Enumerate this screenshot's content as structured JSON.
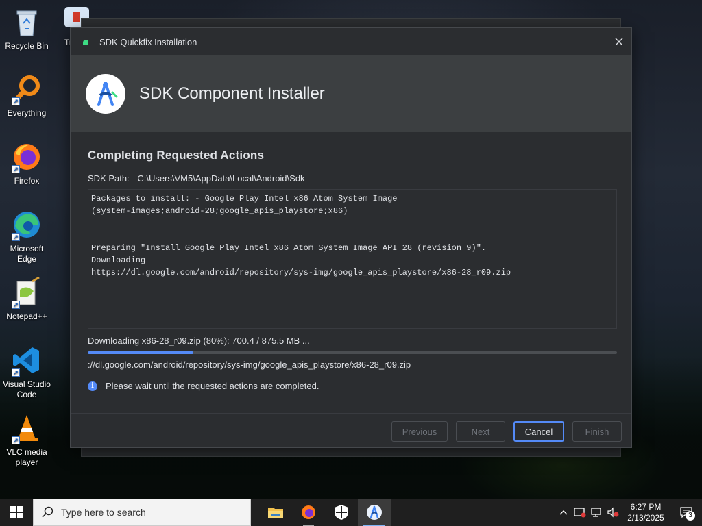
{
  "desktop": {
    "icons": [
      {
        "label": "Recycle Bin",
        "icon": "recycle-bin-icon"
      },
      {
        "label": "Everything",
        "icon": "everything-search-icon"
      },
      {
        "label": "Firefox",
        "icon": "firefox-icon"
      },
      {
        "label": "Microsoft Edge",
        "icon": "edge-icon"
      },
      {
        "label": "Notepad++",
        "icon": "notepadpp-icon"
      },
      {
        "label": "Visual Studio Code",
        "icon": "vscode-icon"
      },
      {
        "label": "VLC media player",
        "icon": "vlc-icon"
      }
    ],
    "partial_labels": [
      "Trac"
    ]
  },
  "dialog": {
    "window_title": "SDK Quickfix Installation",
    "banner_title": "SDK Component Installer",
    "section_title": "Completing Requested Actions",
    "sdk_path_label": "SDK Path:",
    "sdk_path_value": "C:\\Users\\VM5\\AppData\\Local\\Android\\Sdk",
    "log_lines": [
      "Packages to install: - Google Play Intel x86 Atom System Image",
      "(system-images;android-28;google_apis_playstore;x86)",
      "",
      "Preparing \"Install Google Play Intel x86 Atom System Image API 28 (revision 9)\".",
      "Downloading",
      "https://dl.google.com/android/repository/sys-img/google_apis_playstore/x86-28_r09.zip"
    ],
    "progress_label": "Downloading x86-28_r09.zip (80%): 700.4 / 875.5 MB ...",
    "progress_fraction": 0.2,
    "progress_url": "://dl.google.com/android/repository/sys-img/google_apis_playstore/x86-28_r09.zip",
    "info_message": "Please wait until the requested actions are completed.",
    "buttons": {
      "previous": "Previous",
      "next": "Next",
      "cancel": "Cancel",
      "finish": "Finish"
    }
  },
  "taskbar": {
    "search_placeholder": "Type here to search",
    "apps": [
      "file-explorer-icon",
      "firefox-icon",
      "security-icon",
      "android-studio-icon"
    ],
    "time": "6:27 PM",
    "date": "2/13/2025",
    "notification_count": "3"
  },
  "colors": {
    "accent": "#548af7",
    "dialog_bg": "#2b2d30",
    "banner_bg": "#3c3f41"
  }
}
